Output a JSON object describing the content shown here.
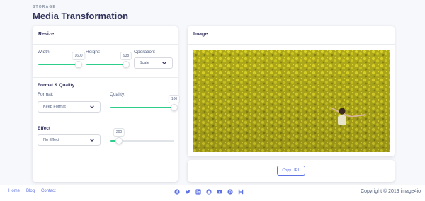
{
  "header": {
    "overline": "STORAGE",
    "title": "Media Transformation"
  },
  "resize": {
    "title": "Resize",
    "width": {
      "label": "Width:",
      "value": "1600"
    },
    "height": {
      "label": "Height:",
      "value": "938"
    },
    "operation": {
      "label": "Operation:",
      "selected": "Scale"
    }
  },
  "format_quality": {
    "title": "Format & Quality",
    "format": {
      "label": "Format:",
      "selected": "Keep Format"
    },
    "quality": {
      "label": "Quality:",
      "value": "100"
    }
  },
  "effect": {
    "title": "Effect",
    "selected": "No Effect",
    "value": "200"
  },
  "image_panel": {
    "title": "Image"
  },
  "copy": {
    "label": "Copy URL"
  },
  "footer": {
    "links": [
      "Home",
      "Blog",
      "Contact"
    ],
    "social_icons": [
      "facebook-icon",
      "twitter-icon",
      "linkedin-icon",
      "github-icon",
      "youtube-icon",
      "pinterest-icon",
      "producthunt-icon"
    ],
    "copyright": "Copyright © 2019 image4io"
  },
  "colors": {
    "accent": "#5e72e4",
    "slider": "#2dce89",
    "title": "#32325d"
  }
}
